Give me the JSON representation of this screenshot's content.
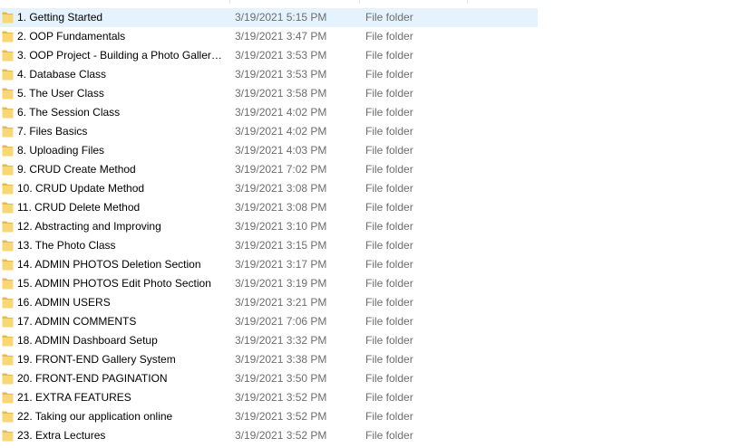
{
  "colors": {
    "selection_bg": "#e5f3ff",
    "folder_yellow": "#f8d775",
    "folder_dark": "#e8b94a",
    "secondary_text": "#6d6d6d"
  },
  "icon": "folder-icon",
  "selected_index": 0,
  "rows": [
    {
      "name": "1. Getting Started",
      "date": "3/19/2021 5:15 PM",
      "type": "File folder"
    },
    {
      "name": "2. OOP Fundamentals",
      "date": "3/19/2021 3:47 PM",
      "type": "File folder"
    },
    {
      "name": "3. OOP Project - Building a Photo Gallery...",
      "date": "3/19/2021 3:53 PM",
      "type": "File folder"
    },
    {
      "name": "4. Database Class",
      "date": "3/19/2021 3:53 PM",
      "type": "File folder"
    },
    {
      "name": "5. The User Class",
      "date": "3/19/2021 3:58 PM",
      "type": "File folder"
    },
    {
      "name": "6. The Session Class",
      "date": "3/19/2021 4:02 PM",
      "type": "File folder"
    },
    {
      "name": "7. Files Basics",
      "date": "3/19/2021 4:02 PM",
      "type": "File folder"
    },
    {
      "name": "8. Uploading Files",
      "date": "3/19/2021 4:03 PM",
      "type": "File folder"
    },
    {
      "name": "9. CRUD Create Method",
      "date": "3/19/2021 7:02 PM",
      "type": "File folder"
    },
    {
      "name": "10. CRUD Update Method",
      "date": "3/19/2021 3:08 PM",
      "type": "File folder"
    },
    {
      "name": "11. CRUD Delete Method",
      "date": "3/19/2021 3:08 PM",
      "type": "File folder"
    },
    {
      "name": "12. Abstracting and Improving",
      "date": "3/19/2021 3:10 PM",
      "type": "File folder"
    },
    {
      "name": "13. The Photo Class",
      "date": "3/19/2021 3:15 PM",
      "type": "File folder"
    },
    {
      "name": "14. ADMIN PHOTOS Deletion Section",
      "date": "3/19/2021 3:17 PM",
      "type": "File folder"
    },
    {
      "name": "15. ADMIN PHOTOS Edit Photo Section",
      "date": "3/19/2021 3:19 PM",
      "type": "File folder"
    },
    {
      "name": "16. ADMIN USERS",
      "date": "3/19/2021 3:21 PM",
      "type": "File folder"
    },
    {
      "name": "17. ADMIN COMMENTS",
      "date": "3/19/2021 7:06 PM",
      "type": "File folder"
    },
    {
      "name": "18. ADMIN Dashboard Setup",
      "date": "3/19/2021 3:32 PM",
      "type": "File folder"
    },
    {
      "name": "19. FRONT-END  Gallery System",
      "date": "3/19/2021 3:38 PM",
      "type": "File folder"
    },
    {
      "name": "20. FRONT-END  PAGINATION",
      "date": "3/19/2021 3:50 PM",
      "type": "File folder"
    },
    {
      "name": "21. EXTRA FEATURES",
      "date": "3/19/2021 3:52 PM",
      "type": "File folder"
    },
    {
      "name": "22. Taking our application online",
      "date": "3/19/2021 3:52 PM",
      "type": "File folder"
    },
    {
      "name": "23. Extra Lectures",
      "date": "3/19/2021 3:52 PM",
      "type": "File folder"
    }
  ]
}
